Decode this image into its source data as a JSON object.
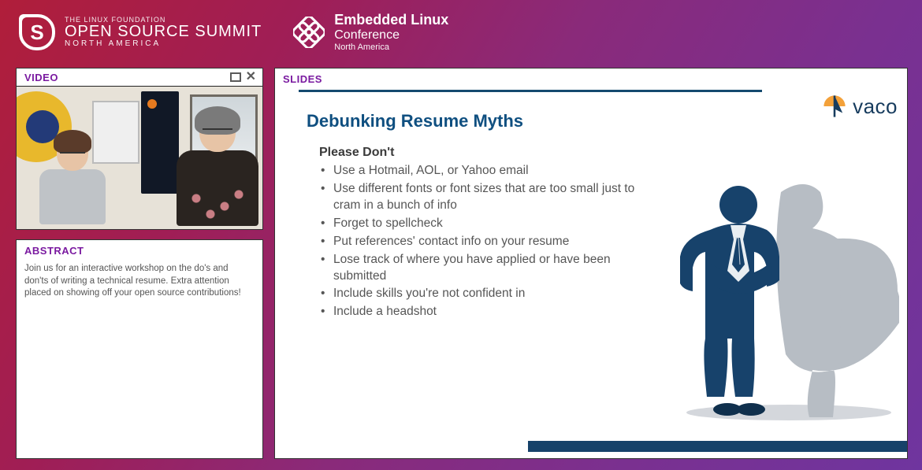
{
  "header": {
    "oss": {
      "tagline": "THE LINUX FOUNDATION",
      "title": "OPEN SOURCE SUMMIT",
      "region": "NORTH AMERICA"
    },
    "elc": {
      "line1": "Embedded Linux",
      "line2": "Conference",
      "region": "North America"
    }
  },
  "video": {
    "label": "VIDEO"
  },
  "abstract": {
    "label": "ABSTRACT",
    "body": "Join us for an interactive workshop on the do's and don'ts of writing a technical resume. Extra attention placed on showing off your open source contributions!"
  },
  "slides": {
    "label": "SLIDES",
    "brand": "vaco",
    "title": "Debunking Resume Myths",
    "subheading": "Please Don't",
    "bullets": [
      "Use a Hotmail, AOL, or Yahoo email",
      "Use different fonts or font sizes that are too small just to cram in a bunch of info",
      "Forget to spellcheck",
      "Put references' contact info on your resume",
      "Lose track of where you have applied or have been submitted",
      "Include skills you're not confident in",
      "Include a headshot"
    ]
  }
}
